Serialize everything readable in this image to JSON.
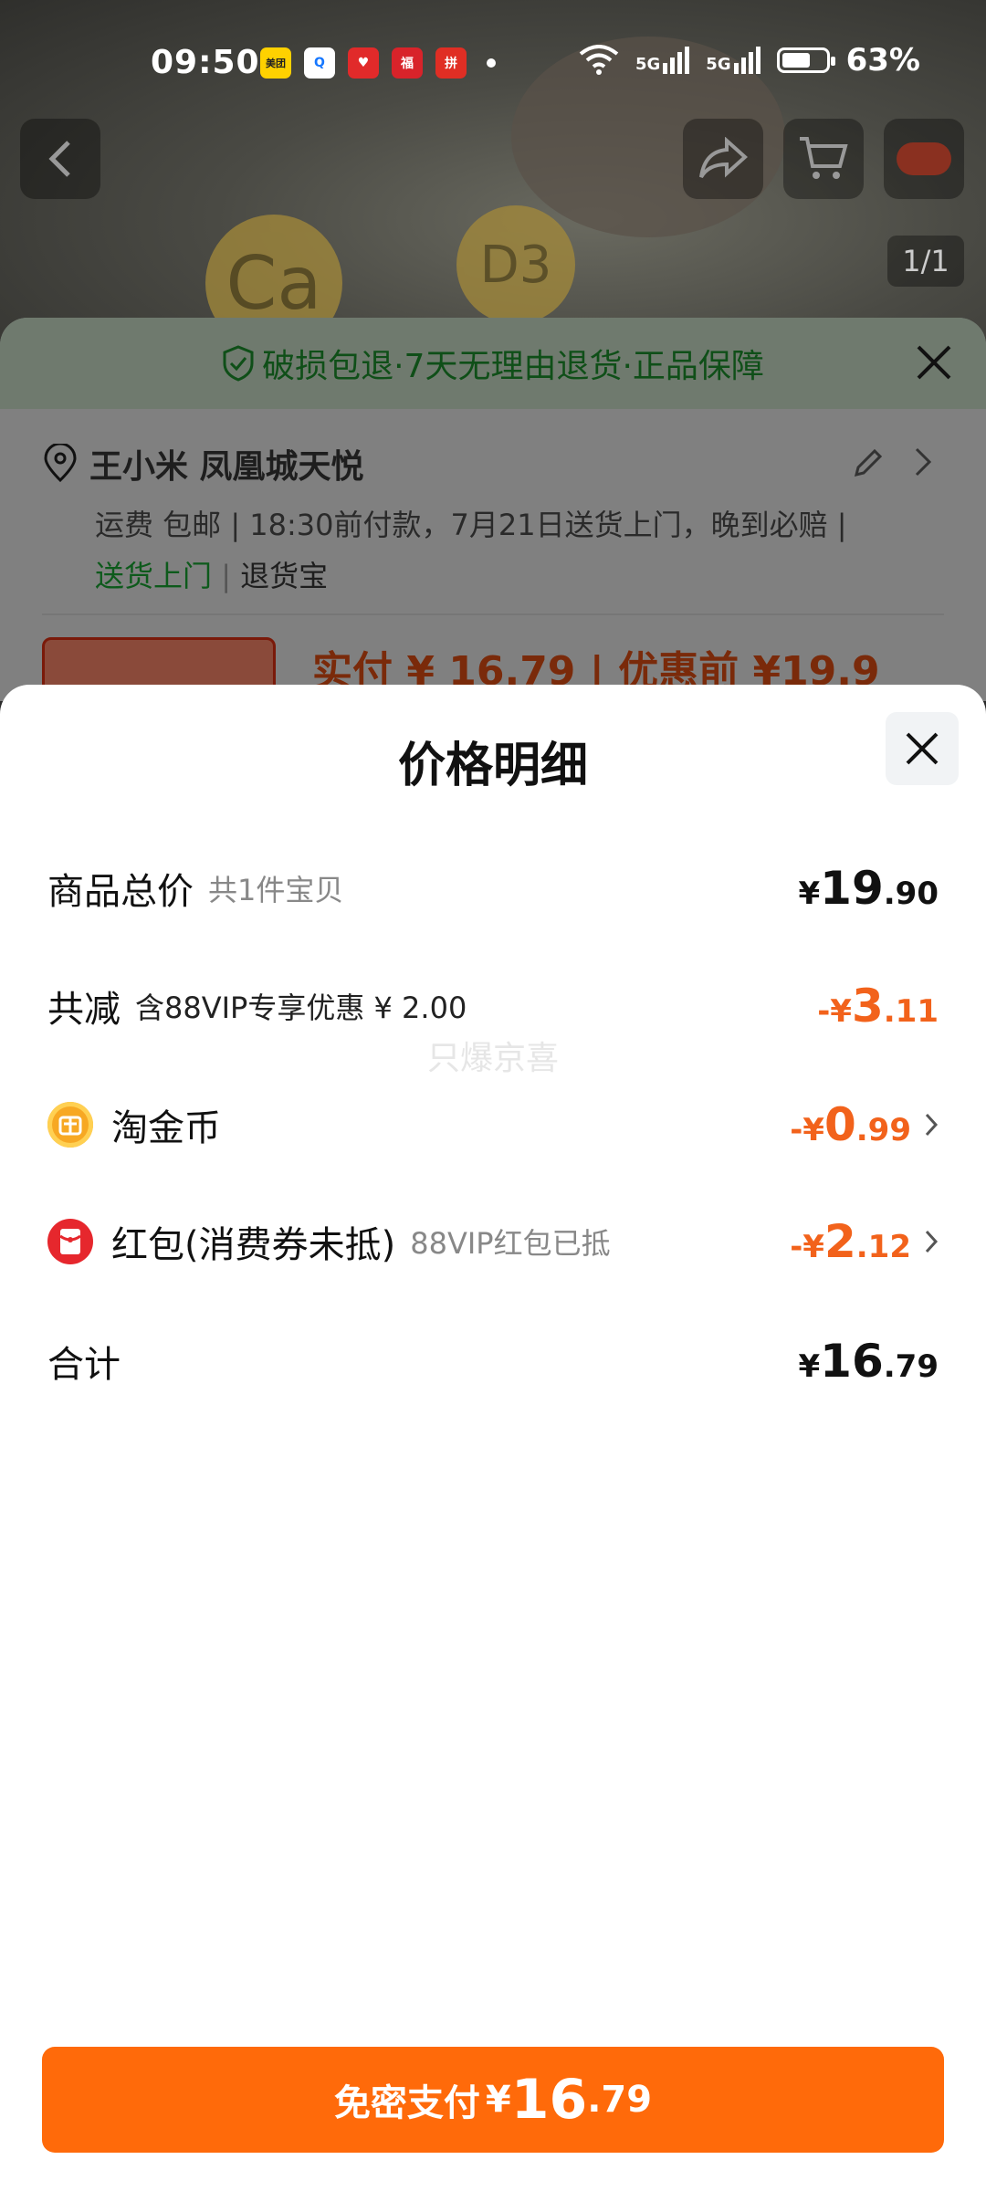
{
  "status_bar": {
    "time": "09:50",
    "apps": [
      "美团",
      "Q",
      "♥",
      "福",
      "拼"
    ],
    "network_1": "5G",
    "network_2": "5G",
    "battery": "63%"
  },
  "hero": {
    "badge_ca": "Ca",
    "badge_d3": "D3",
    "page_counter": "1/1"
  },
  "background_sheet": {
    "guarantee_text": "破损包退·7天无理由退货·正品保障",
    "address_name": "王小米 凤凰城天悦",
    "shipping_info": "运费 包邮 | 18:30前付款，7月21日送货上门，晚到必赔 |",
    "delivery_label": "送货上门",
    "return_label": "退货宝",
    "pay_peek": "实付 ¥ 16.79 | 优惠前 ¥19.9"
  },
  "price_sheet": {
    "title": "价格明细",
    "watermark": "只爆京喜",
    "rows": [
      {
        "label": "商品总价",
        "sub": "共1件宝贝",
        "prefix": "¥",
        "int": "19",
        "dec": ".90"
      },
      {
        "label": "共减",
        "sub": "含88VIP专享优惠 ¥ 2.00",
        "prefix": "-¥",
        "int": "3",
        "dec": ".11"
      },
      {
        "label": "淘金币",
        "sub": "",
        "prefix": "-¥",
        "int": "0",
        "dec": ".99"
      },
      {
        "label": "红包(消费券未抵)",
        "sub": "88VIP红包已抵",
        "prefix": "-¥",
        "int": "2",
        "dec": ".12"
      },
      {
        "label": "合计",
        "sub": "",
        "prefix": "¥",
        "int": "16",
        "dec": ".79"
      }
    ],
    "pay_button": {
      "text": "免密支付",
      "prefix": "¥",
      "int": "16",
      "dec": ".79"
    }
  },
  "colors": {
    "accent": "#ff6a0a",
    "discount": "#f2621b"
  }
}
